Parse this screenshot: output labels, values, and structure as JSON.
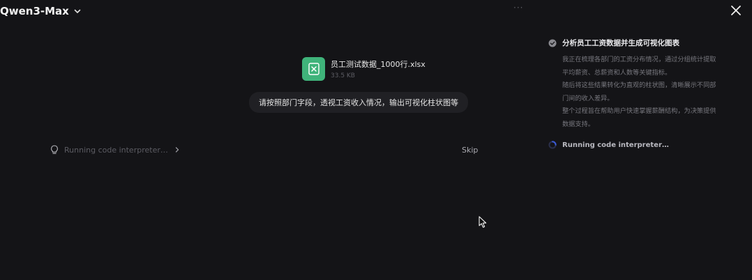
{
  "header": {
    "model_name": "Qwen3-Max",
    "dots": "···"
  },
  "file": {
    "name": "员工测试数据_1000行.xlsx",
    "size": "33.5 KB",
    "icon": "excel-file-icon",
    "icon_color": "#3fb37a"
  },
  "user_message": "请按照部门字段，透视工资收入情况，输出可视化柱状图等",
  "run_row": {
    "text": "Running code interpreter…",
    "skip_label": "Skip"
  },
  "right_panel": {
    "step_title": "分析员工工资数据并生成可视化图表",
    "step_lines": [
      "我正在梳理各部门的工资分布情况，通过分组统计提取",
      "平均薪资、总薪资和人数等关键指标。",
      "随后将这些结果转化为直观的柱状图，清晰展示不同部",
      "门间的收入差异。",
      "整个过程旨在帮助用户快速掌握薪酬结构，为决策提供",
      "数据支持。"
    ],
    "running_label": "Running code interpreter…"
  },
  "colors": {
    "background": "#141417",
    "bubble": "#202024",
    "spinner": "#3b5bd6"
  }
}
